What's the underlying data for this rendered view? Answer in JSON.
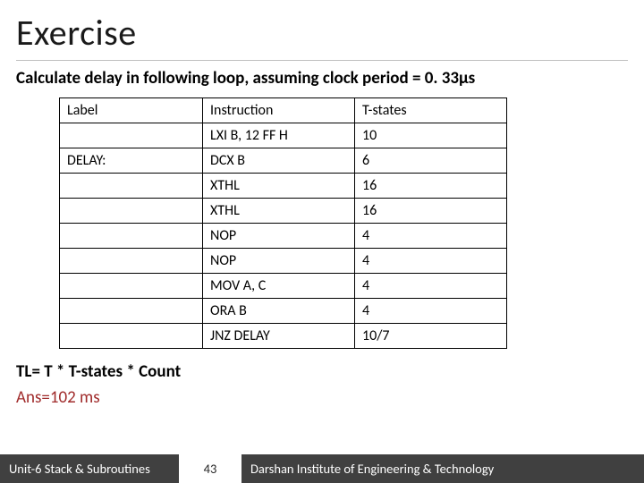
{
  "title": "Exercise",
  "subtitle": "Calculate delay in following loop, assuming clock period = 0. 33µs",
  "table": {
    "headers": [
      "Label",
      "Instruction",
      "T-states"
    ],
    "rows": [
      [
        "",
        "LXI B, 12 FF H",
        "10"
      ],
      [
        "DELAY:",
        "DCX B",
        "6"
      ],
      [
        "",
        "XTHL",
        "16"
      ],
      [
        "",
        "XTHL",
        "16"
      ],
      [
        "",
        "NOP",
        "4"
      ],
      [
        "",
        "NOP",
        "4"
      ],
      [
        "",
        "MOV A, C",
        "4"
      ],
      [
        "",
        "ORA B",
        "4"
      ],
      [
        "",
        "JNZ DELAY",
        "10/7"
      ]
    ]
  },
  "formula": "TL= T * T-states * Count",
  "answer": "Ans=102 ms",
  "footer": {
    "left": "Unit-6 Stack & Subroutines",
    "page": "43",
    "right": "Darshan Institute of Engineering & Technology"
  },
  "chart_data": {
    "type": "table",
    "title": "Delay loop T-state table",
    "columns": [
      "Label",
      "Instruction",
      "T-states"
    ],
    "rows": [
      {
        "Label": "",
        "Instruction": "LXI B, 12 FF H",
        "T-states": "10"
      },
      {
        "Label": "DELAY:",
        "Instruction": "DCX B",
        "T-states": "6"
      },
      {
        "Label": "",
        "Instruction": "XTHL",
        "T-states": "16"
      },
      {
        "Label": "",
        "Instruction": "XTHL",
        "T-states": "16"
      },
      {
        "Label": "",
        "Instruction": "NOP",
        "T-states": "4"
      },
      {
        "Label": "",
        "Instruction": "NOP",
        "T-states": "4"
      },
      {
        "Label": "",
        "Instruction": "MOV A, C",
        "T-states": "4"
      },
      {
        "Label": "",
        "Instruction": "ORA B",
        "T-states": "4"
      },
      {
        "Label": "",
        "Instruction": "JNZ DELAY",
        "T-states": "10/7"
      }
    ],
    "clock_period_us": 0.33,
    "formula": "TL = T * T-states * Count",
    "answer_ms": 102
  }
}
